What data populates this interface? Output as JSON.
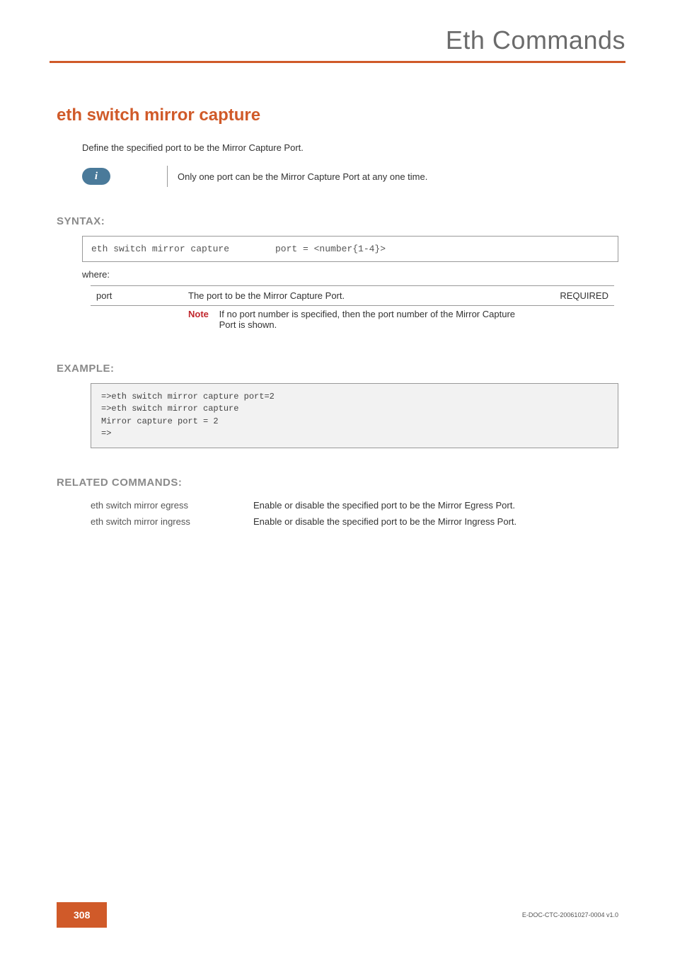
{
  "header": {
    "category": "Eth Commands"
  },
  "title": "eth switch mirror capture",
  "intro": "Define the specified port to be the Mirror Capture Port.",
  "info_icon_glyph": "i",
  "info_note": "Only one port can be the Mirror Capture Port at any one time.",
  "syntax": {
    "label": "SYNTAX:",
    "command": "eth switch mirror capture",
    "args": "port = <number{1-4}>"
  },
  "where_label": "where:",
  "params": [
    {
      "name": "port",
      "desc": "The port to be the Mirror Capture Port.",
      "req": "REQUIRED",
      "note_label": "Note",
      "note_text": "If no port number is specified, then the port number of the Mirror Capture Port is shown."
    }
  ],
  "example": {
    "label": "EXAMPLE:",
    "body": "=>eth switch mirror capture port=2\n=>eth switch mirror capture\nMirror capture port = 2\n=>"
  },
  "related": {
    "label": "RELATED COMMANDS:",
    "rows": [
      {
        "cmd": "eth switch mirror egress",
        "desc": "Enable or disable the specified port to be the Mirror Egress Port."
      },
      {
        "cmd": "eth switch mirror ingress",
        "desc": "Enable or disable the specified port to be the Mirror Ingress Port."
      }
    ]
  },
  "footer": {
    "page": "308",
    "docid": "E-DOC-CTC-20061027-0004 v1.0"
  }
}
